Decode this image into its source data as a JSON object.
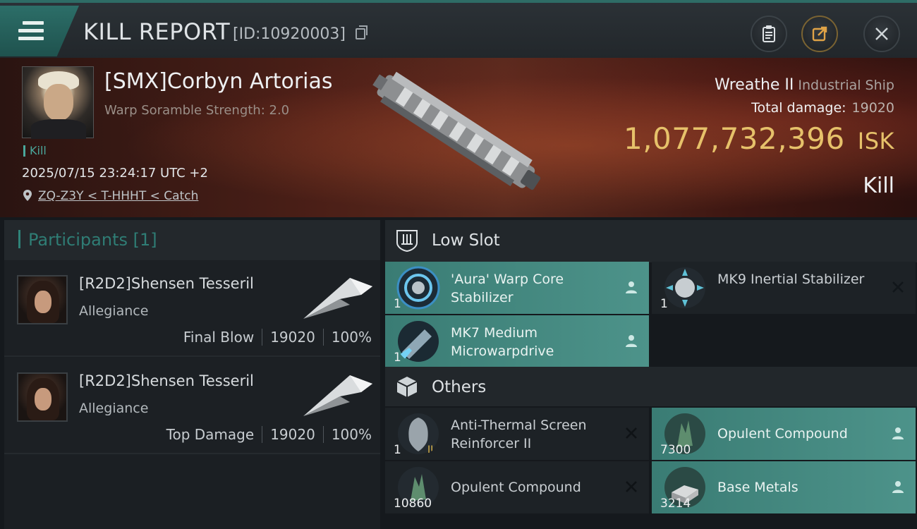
{
  "header": {
    "title": "KILL REPORT",
    "report_id": "[ID:10920003]"
  },
  "victim": {
    "name": "[SMX]Corbyn Artorias",
    "warp_scramble": "Warp Soramble Strength: 2.0",
    "kill_tag": "Kill",
    "time": "2025/07/15 23:24:17 UTC +2",
    "location": "ZQ-Z3Y < T-HHHT < Catch",
    "ship_name": "Wreathe II",
    "ship_class": "Industrial Ship",
    "damage_label": "Total damage:",
    "damage_value": "19020",
    "isk_value": "1,077,732,396",
    "isk_unit": "ISK",
    "result": "Kill"
  },
  "participants": {
    "title": "Participants [1]",
    "rows": [
      {
        "name": "[R2D2]Shensen Tesseril",
        "corp": "Allegiance",
        "role": "Final Blow",
        "damage": "19020",
        "percent": "100%"
      },
      {
        "name": "[R2D2]Shensen Tesseril",
        "corp": "Allegiance",
        "role": "Top Damage",
        "damage": "19020",
        "percent": "100%"
      }
    ]
  },
  "low_slot": {
    "title": "Low Slot",
    "items": [
      {
        "name": "'Aura' Warp Core Stabilizer",
        "qty": "1",
        "status": "dropped"
      },
      {
        "name": "MK9 Inertial Stabilizer",
        "qty": "1",
        "status": "destroyed"
      },
      {
        "name": "MK7 Medium Microwarpdrive",
        "qty": "1",
        "status": "dropped"
      }
    ]
  },
  "others": {
    "title": "Others",
    "items": [
      {
        "name": "Anti-Thermal Screen Reinforcer II",
        "qty": "1",
        "status": "destroyed"
      },
      {
        "name": "Opulent Compound",
        "qty": "7300",
        "status": "dropped"
      },
      {
        "name": "Opulent Compound",
        "qty": "10860",
        "status": "destroyed"
      },
      {
        "name": "Base Metals",
        "qty": "3214",
        "status": "dropped"
      }
    ]
  },
  "colors": {
    "accent_teal": "#4d938a",
    "isk_gold": "#e6c16a",
    "banner_red": "#4b1f17"
  }
}
